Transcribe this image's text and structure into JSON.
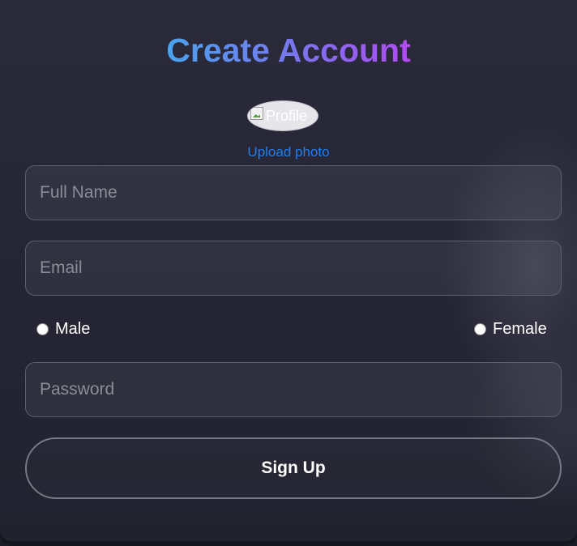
{
  "form": {
    "title": "Create Account",
    "avatar_alt": "Profile",
    "upload_label": "Upload photo",
    "fields": {
      "full_name": {
        "placeholder": "Full Name",
        "value": ""
      },
      "email": {
        "placeholder": "Email",
        "value": ""
      },
      "password": {
        "placeholder": "Password",
        "value": ""
      }
    },
    "gender": {
      "options": [
        "Male",
        "Female"
      ],
      "selected": null
    },
    "submit_label": "Sign Up"
  },
  "colors": {
    "title_gradient": [
      "#4aa3ee",
      "#7b73ee",
      "#b14bf2"
    ],
    "link": "#1e7ff0",
    "background": "#262636"
  },
  "icons": {
    "avatar": "broken-image-icon"
  }
}
